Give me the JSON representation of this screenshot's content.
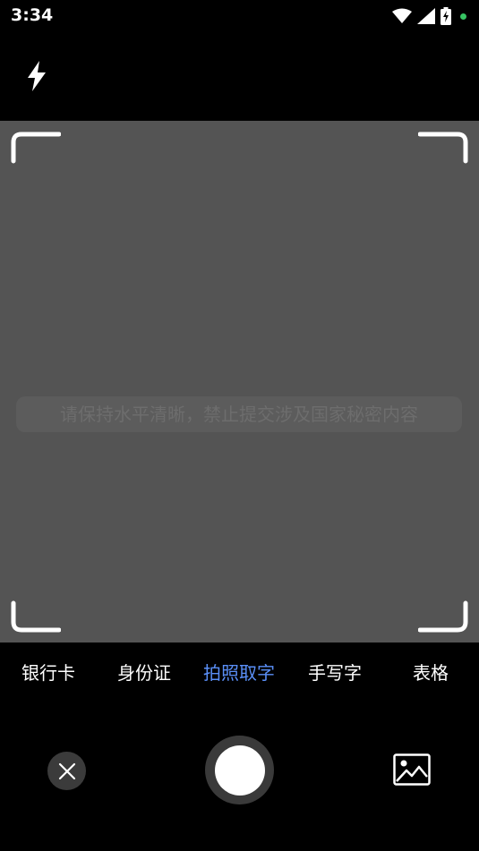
{
  "status_bar": {
    "time": "3:34",
    "icons": [
      "wifi-icon",
      "signal-icon",
      "battery-charging-icon",
      "notification-dot"
    ],
    "dot_color": "#37c463"
  },
  "toolbar": {
    "flash_icon": "flash-icon"
  },
  "viewfinder": {
    "hint": "请保持水平清晰，禁止提交涉及国家秘密内容",
    "background": "#545454"
  },
  "modes": {
    "items": [
      {
        "label": "银行卡",
        "active": false
      },
      {
        "label": "身份证",
        "active": false
      },
      {
        "label": "拍照取字",
        "active": true
      },
      {
        "label": "手写字",
        "active": false
      },
      {
        "label": "表格",
        "active": false
      }
    ],
    "active_color": "#5a8ff7"
  },
  "controls": {
    "close_icon": "close-icon",
    "shutter": "shutter-button",
    "gallery_icon": "image-gallery-icon"
  }
}
